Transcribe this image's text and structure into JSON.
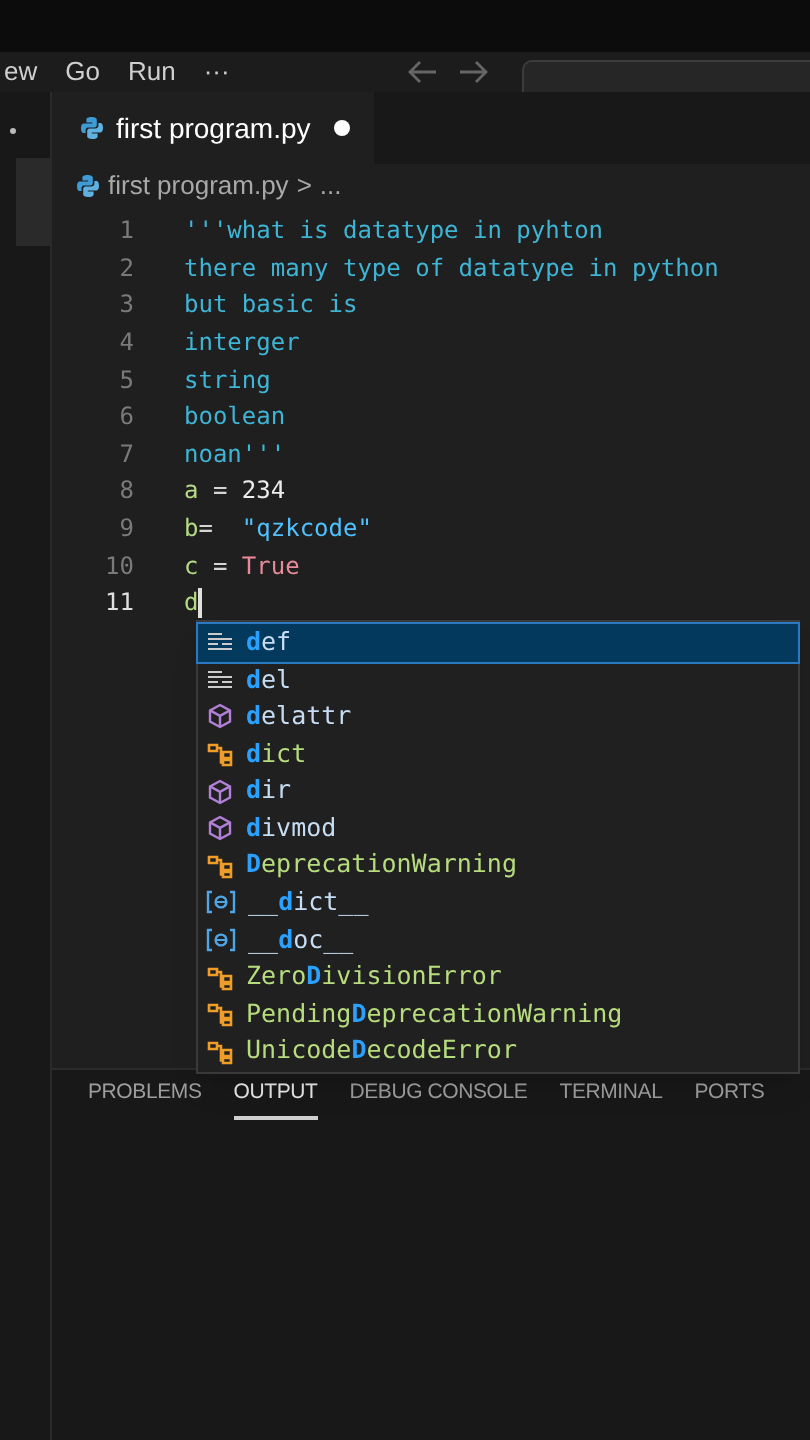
{
  "menu": [
    "ew",
    "Go",
    "Run",
    "···"
  ],
  "tabs": [
    {
      "label": "first program.py",
      "selected": true,
      "modified": true
    }
  ],
  "breadcrumb": [
    "first program.py",
    ">",
    "..."
  ],
  "editor": {
    "lines": [
      {
        "number": "1",
        "current": false,
        "tokens": [
          {
            "text": "'''what is datatype in pyhton",
            "kind": "string"
          }
        ]
      },
      {
        "number": "2",
        "current": false,
        "tokens": [
          {
            "text": "there many type of datatype in python",
            "kind": "string"
          }
        ]
      },
      {
        "number": "3",
        "current": false,
        "tokens": [
          {
            "text": "but basic is",
            "kind": "string"
          }
        ]
      },
      {
        "number": "4",
        "current": false,
        "tokens": [
          {
            "text": "interger",
            "kind": "string"
          }
        ]
      },
      {
        "number": "5",
        "current": false,
        "tokens": [
          {
            "text": "string",
            "kind": "string"
          }
        ]
      },
      {
        "number": "6",
        "current": false,
        "tokens": [
          {
            "text": "boolean",
            "kind": "string"
          }
        ]
      },
      {
        "number": "7",
        "current": false,
        "tokens": [
          {
            "text": "noan'''",
            "kind": "string"
          }
        ]
      },
      {
        "number": "8",
        "current": false,
        "tokens": [
          {
            "text": "a",
            "kind": "variable"
          },
          {
            "text": " = ",
            "kind": "operator"
          },
          {
            "text": "234",
            "kind": "number"
          }
        ]
      },
      {
        "number": "9",
        "current": false,
        "tokens": [
          {
            "text": "b",
            "kind": "variable"
          },
          {
            "text": "=  ",
            "kind": "operator"
          },
          {
            "text": "\"qzkcode\"",
            "kind": "literal"
          }
        ]
      },
      {
        "number": "10",
        "current": false,
        "tokens": [
          {
            "text": "c",
            "kind": "variable"
          },
          {
            "text": " = ",
            "kind": "operator"
          },
          {
            "text": "True",
            "kind": "constant"
          }
        ]
      },
      {
        "number": "11",
        "current": true,
        "tokens": [
          {
            "text": "d",
            "kind": "variable"
          }
        ]
      }
    ]
  },
  "suggestions": [
    {
      "kind": "keyword",
      "match": "d",
      "after": "ef",
      "selected": true
    },
    {
      "kind": "keyword",
      "match": "d",
      "after": "el",
      "selected": false
    },
    {
      "kind": "function",
      "match": "d",
      "after": "elattr",
      "selected": false
    },
    {
      "kind": "class",
      "match": "d",
      "after": "ict",
      "selected": false
    },
    {
      "kind": "function",
      "match": "d",
      "after": "ir",
      "selected": false
    },
    {
      "kind": "function",
      "match": "d",
      "after": "ivmod",
      "selected": false
    },
    {
      "kind": "class",
      "match": "D",
      "after": "eprecationWarning",
      "selected": false
    },
    {
      "kind": "field",
      "before": "__",
      "match": "d",
      "after": "ict__",
      "selected": false
    },
    {
      "kind": "field",
      "before": "__",
      "match": "d",
      "after": "oc__",
      "selected": false
    },
    {
      "kind": "class",
      "before": "Zero",
      "match": "D",
      "after": "ivisionError",
      "selected": false
    },
    {
      "kind": "class",
      "before": "Pending",
      "match": "D",
      "after": "eprecationWarning",
      "selected": false
    },
    {
      "kind": "class",
      "before": "Unicode",
      "match": "D",
      "after": "ecodeError",
      "selected": false
    }
  ],
  "panel_tabs": [
    {
      "label": "PROBLEMS",
      "selected": false
    },
    {
      "label": "OUTPUT",
      "selected": true
    },
    {
      "label": "DEBUG CONSOLE",
      "selected": false
    },
    {
      "label": "TERMINAL",
      "selected": false
    },
    {
      "label": "PORTS",
      "selected": false
    }
  ]
}
